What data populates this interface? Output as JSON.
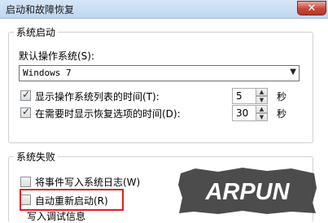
{
  "window": {
    "title": "启动和故障恢复",
    "close_glyph": "✕"
  },
  "system_startup": {
    "group_label": "系统启动",
    "default_os_label": "默认操作系统(S):",
    "default_os_value": "Windows 7",
    "show_os_list": {
      "label": "显示操作系统列表的时间(T):",
      "checked": true,
      "value": "5",
      "unit": "秒"
    },
    "show_recovery": {
      "label": "在需要时显示恢复选项的时间(D):",
      "checked": true,
      "value": "30",
      "unit": "秒"
    }
  },
  "system_failure": {
    "group_label": "系统失败",
    "write_event": {
      "label": "将事件写入系统日志(W)",
      "checked": false
    },
    "auto_restart": {
      "label": "自动重新启动(R)",
      "checked": false
    },
    "debug_info_partial": "写入调试信息"
  },
  "watermark": {
    "text": "ARPUN"
  },
  "colors": {
    "highlight": "#e31b1b",
    "titlebar": "#c8dbf1"
  }
}
